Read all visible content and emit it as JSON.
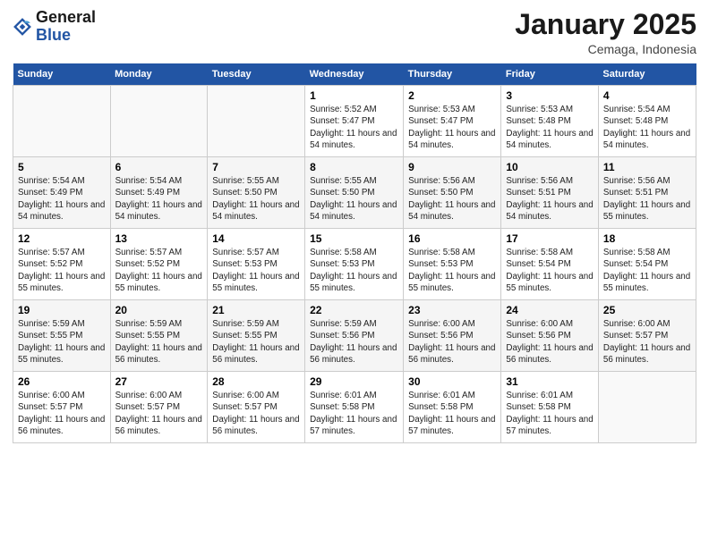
{
  "logo": {
    "text_general": "General",
    "text_blue": "Blue"
  },
  "header": {
    "title": "January 2025",
    "subtitle": "Cemaga, Indonesia"
  },
  "columns": [
    "Sunday",
    "Monday",
    "Tuesday",
    "Wednesday",
    "Thursday",
    "Friday",
    "Saturday"
  ],
  "weeks": [
    [
      {
        "day": "",
        "info": ""
      },
      {
        "day": "",
        "info": ""
      },
      {
        "day": "",
        "info": ""
      },
      {
        "day": "1",
        "info": "Sunrise: 5:52 AM\nSunset: 5:47 PM\nDaylight: 11 hours and 54 minutes."
      },
      {
        "day": "2",
        "info": "Sunrise: 5:53 AM\nSunset: 5:47 PM\nDaylight: 11 hours and 54 minutes."
      },
      {
        "day": "3",
        "info": "Sunrise: 5:53 AM\nSunset: 5:48 PM\nDaylight: 11 hours and 54 minutes."
      },
      {
        "day": "4",
        "info": "Sunrise: 5:54 AM\nSunset: 5:48 PM\nDaylight: 11 hours and 54 minutes."
      }
    ],
    [
      {
        "day": "5",
        "info": "Sunrise: 5:54 AM\nSunset: 5:49 PM\nDaylight: 11 hours and 54 minutes."
      },
      {
        "day": "6",
        "info": "Sunrise: 5:54 AM\nSunset: 5:49 PM\nDaylight: 11 hours and 54 minutes."
      },
      {
        "day": "7",
        "info": "Sunrise: 5:55 AM\nSunset: 5:50 PM\nDaylight: 11 hours and 54 minutes."
      },
      {
        "day": "8",
        "info": "Sunrise: 5:55 AM\nSunset: 5:50 PM\nDaylight: 11 hours and 54 minutes."
      },
      {
        "day": "9",
        "info": "Sunrise: 5:56 AM\nSunset: 5:50 PM\nDaylight: 11 hours and 54 minutes."
      },
      {
        "day": "10",
        "info": "Sunrise: 5:56 AM\nSunset: 5:51 PM\nDaylight: 11 hours and 54 minutes."
      },
      {
        "day": "11",
        "info": "Sunrise: 5:56 AM\nSunset: 5:51 PM\nDaylight: 11 hours and 55 minutes."
      }
    ],
    [
      {
        "day": "12",
        "info": "Sunrise: 5:57 AM\nSunset: 5:52 PM\nDaylight: 11 hours and 55 minutes."
      },
      {
        "day": "13",
        "info": "Sunrise: 5:57 AM\nSunset: 5:52 PM\nDaylight: 11 hours and 55 minutes."
      },
      {
        "day": "14",
        "info": "Sunrise: 5:57 AM\nSunset: 5:53 PM\nDaylight: 11 hours and 55 minutes."
      },
      {
        "day": "15",
        "info": "Sunrise: 5:58 AM\nSunset: 5:53 PM\nDaylight: 11 hours and 55 minutes."
      },
      {
        "day": "16",
        "info": "Sunrise: 5:58 AM\nSunset: 5:53 PM\nDaylight: 11 hours and 55 minutes."
      },
      {
        "day": "17",
        "info": "Sunrise: 5:58 AM\nSunset: 5:54 PM\nDaylight: 11 hours and 55 minutes."
      },
      {
        "day": "18",
        "info": "Sunrise: 5:58 AM\nSunset: 5:54 PM\nDaylight: 11 hours and 55 minutes."
      }
    ],
    [
      {
        "day": "19",
        "info": "Sunrise: 5:59 AM\nSunset: 5:55 PM\nDaylight: 11 hours and 55 minutes."
      },
      {
        "day": "20",
        "info": "Sunrise: 5:59 AM\nSunset: 5:55 PM\nDaylight: 11 hours and 56 minutes."
      },
      {
        "day": "21",
        "info": "Sunrise: 5:59 AM\nSunset: 5:55 PM\nDaylight: 11 hours and 56 minutes."
      },
      {
        "day": "22",
        "info": "Sunrise: 5:59 AM\nSunset: 5:56 PM\nDaylight: 11 hours and 56 minutes."
      },
      {
        "day": "23",
        "info": "Sunrise: 6:00 AM\nSunset: 5:56 PM\nDaylight: 11 hours and 56 minutes."
      },
      {
        "day": "24",
        "info": "Sunrise: 6:00 AM\nSunset: 5:56 PM\nDaylight: 11 hours and 56 minutes."
      },
      {
        "day": "25",
        "info": "Sunrise: 6:00 AM\nSunset: 5:57 PM\nDaylight: 11 hours and 56 minutes."
      }
    ],
    [
      {
        "day": "26",
        "info": "Sunrise: 6:00 AM\nSunset: 5:57 PM\nDaylight: 11 hours and 56 minutes."
      },
      {
        "day": "27",
        "info": "Sunrise: 6:00 AM\nSunset: 5:57 PM\nDaylight: 11 hours and 56 minutes."
      },
      {
        "day": "28",
        "info": "Sunrise: 6:00 AM\nSunset: 5:57 PM\nDaylight: 11 hours and 56 minutes."
      },
      {
        "day": "29",
        "info": "Sunrise: 6:01 AM\nSunset: 5:58 PM\nDaylight: 11 hours and 57 minutes."
      },
      {
        "day": "30",
        "info": "Sunrise: 6:01 AM\nSunset: 5:58 PM\nDaylight: 11 hours and 57 minutes."
      },
      {
        "day": "31",
        "info": "Sunrise: 6:01 AM\nSunset: 5:58 PM\nDaylight: 11 hours and 57 minutes."
      },
      {
        "day": "",
        "info": ""
      }
    ]
  ]
}
